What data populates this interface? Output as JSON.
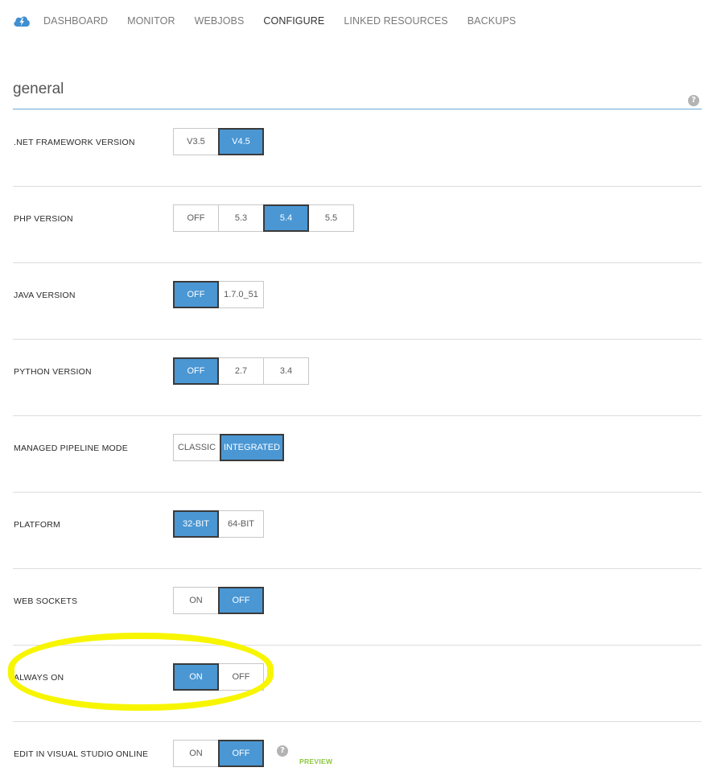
{
  "nav": {
    "logo_icon": "cloud-lightning-icon",
    "items": [
      {
        "label": "DASHBOARD",
        "active": false
      },
      {
        "label": "MONITOR",
        "active": false
      },
      {
        "label": "WEBJOBS",
        "active": false
      },
      {
        "label": "CONFIGURE",
        "active": true
      },
      {
        "label": "LINKED RESOURCES",
        "active": false
      },
      {
        "label": "BACKUPS",
        "active": false
      }
    ]
  },
  "section": {
    "title": "general",
    "help_icon": "question-circle-icon"
  },
  "settings": [
    {
      "label": ".NET FRAMEWORK VERSION",
      "options": [
        "V3.5",
        "V4.5"
      ],
      "selected": 1
    },
    {
      "label": "PHP VERSION",
      "options": [
        "OFF",
        "5.3",
        "5.4",
        "5.5"
      ],
      "selected": 2
    },
    {
      "label": "JAVA VERSION",
      "options": [
        "OFF",
        "1.7.0_51"
      ],
      "selected": 0
    },
    {
      "label": "PYTHON VERSION",
      "options": [
        "OFF",
        "2.7",
        "3.4"
      ],
      "selected": 0
    },
    {
      "label": "MANAGED PIPELINE MODE",
      "options": [
        "CLASSIC",
        "INTEGRATED"
      ],
      "selected": 1
    },
    {
      "label": "PLATFORM",
      "options": [
        "32-BIT",
        "64-BIT"
      ],
      "selected": 0
    },
    {
      "label": "WEB SOCKETS",
      "options": [
        "ON",
        "OFF"
      ],
      "selected": 1
    },
    {
      "label": "ALWAYS ON",
      "options": [
        "ON",
        "OFF"
      ],
      "selected": 0
    },
    {
      "label": "EDIT IN VISUAL STUDIO ONLINE",
      "options": [
        "ON",
        "OFF"
      ],
      "selected": 1,
      "help_icon": "question-circle-icon",
      "badge": "PREVIEW"
    }
  ],
  "colors": {
    "accent": "#4a97d4",
    "highlight": "#f7f500",
    "preview": "#8cc63e",
    "rule": "#6aa8d8"
  }
}
